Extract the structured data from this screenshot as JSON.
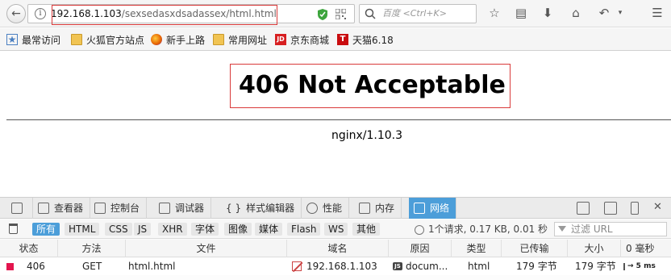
{
  "toolbar": {
    "url_host": "192.168.1.103",
    "url_path": "/sexsedasxdsadassex/html.html",
    "search_placeholder": "百度 <Ctrl+K>"
  },
  "bookmarks": [
    {
      "label": "最常访问",
      "icon": "star-icon"
    },
    {
      "label": "火狐官方站点",
      "icon": "folder-icon"
    },
    {
      "label": "新手上路",
      "icon": "firefox-icon"
    },
    {
      "label": "常用网址",
      "icon": "folder-icon"
    },
    {
      "label": "京东商城",
      "icon": "jd-icon",
      "icon_text": "JD"
    },
    {
      "label": "天猫6.18",
      "icon": "tmall-icon",
      "icon_text": "T"
    }
  ],
  "page": {
    "title": "406 Not Acceptable",
    "server": "nginx/1.10.3"
  },
  "devtools": {
    "tabs": [
      {
        "label": "查看器",
        "icon": "inspector-icon"
      },
      {
        "label": "控制台",
        "icon": "console-icon"
      },
      {
        "label": "调试器",
        "icon": "debugger-icon"
      },
      {
        "label": "样式编辑器",
        "icon": "style-editor-icon",
        "prefix": "{ }"
      },
      {
        "label": "性能",
        "icon": "performance-icon"
      },
      {
        "label": "内存",
        "icon": "memory-icon"
      },
      {
        "label": "网络",
        "icon": "network-icon",
        "active": true
      }
    ],
    "filters": [
      "所有",
      "HTML",
      "CSS",
      "JS",
      "XHR",
      "字体",
      "图像",
      "媒体",
      "Flash",
      "WS",
      "其他"
    ],
    "active_filter": "所有",
    "summary": "1个请求, 0.17 KB, 0.01 秒",
    "url_filter_placeholder": "过滤 URL",
    "columns": [
      "状态",
      "方法",
      "文件",
      "域名",
      "原因",
      "类型",
      "已传输",
      "大小",
      "0 毫秒"
    ],
    "requests": [
      {
        "status": "406",
        "method": "GET",
        "file": "html.html",
        "domain": "192.168.1.103",
        "cause": "docum...",
        "type": "html",
        "transferred": "179 字节",
        "size": "179 字节",
        "timing": "→ 5 ms"
      }
    ]
  },
  "colors": {
    "accent": "#4c9ed9",
    "highlight_border": "#d93a3a",
    "status_error": "#e3154e"
  }
}
